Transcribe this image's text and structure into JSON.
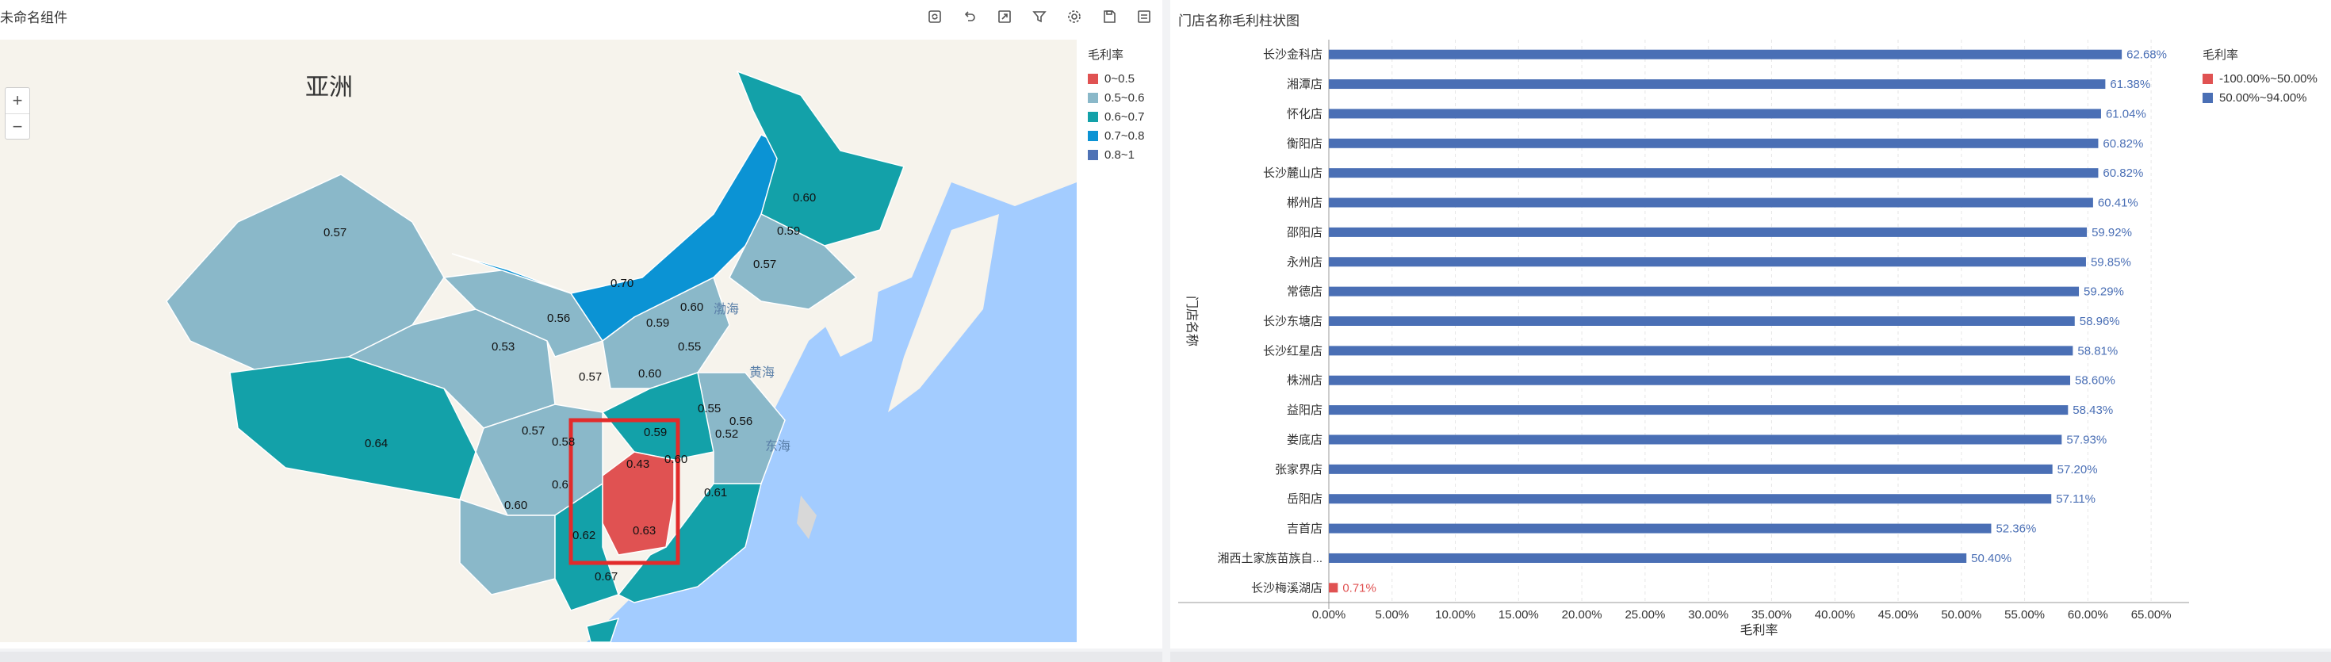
{
  "left": {
    "title": "未命名组件",
    "toolbar": [
      {
        "name": "refresh-icon"
      },
      {
        "name": "undo-icon"
      },
      {
        "name": "export-icon"
      },
      {
        "name": "filter-icon"
      },
      {
        "name": "settings-icon"
      },
      {
        "name": "save-icon"
      },
      {
        "name": "fullscreen-icon"
      }
    ],
    "zoom_in": "+",
    "zoom_out": "−",
    "map_labels": {
      "asia": "亚洲",
      "bohai": "渤海",
      "yellow_sea": "黄海",
      "east_sea": "东海"
    },
    "legend": {
      "title": "毛利率",
      "items": [
        {
          "label": "0~0.5",
          "color": "#e05252"
        },
        {
          "label": "0.5~0.6",
          "color": "#8ab8c9"
        },
        {
          "label": "0.6~0.7",
          "color": "#13a1a9"
        },
        {
          "label": "0.7~0.8",
          "color": "#0b93d4"
        },
        {
          "label": "0.8~1",
          "color": "#4f72b5"
        }
      ]
    },
    "province_values": [
      "0.57",
      "0.64",
      "0.53",
      "0.56",
      "0.70",
      "0.60",
      "0.59",
      "0.57",
      "0.59",
      "0.60",
      "0.55",
      "0.57",
      "0.60",
      "0.55",
      "0.56",
      "0.52",
      "0.57",
      "0.58",
      "0.43",
      "0.59",
      "0.60",
      "0.61",
      "0.6",
      "0.60",
      "0.62",
      "0.63",
      "0.67"
    ]
  },
  "right": {
    "title": "门店名称毛利柱状图",
    "legend": {
      "title": "毛利率",
      "items": [
        {
          "label": "-100.00%~50.00%",
          "color": "#e05252"
        },
        {
          "label": "50.00%~94.00%",
          "color": "#4a6fb5"
        }
      ]
    }
  },
  "chart_data": {
    "type": "bar",
    "orientation": "horizontal",
    "xlabel": "毛利率",
    "ylabel": "门店名称",
    "xlim": [
      0,
      0.68
    ],
    "x_ticks": [
      "0.00%",
      "5.00%",
      "10.00%",
      "15.00%",
      "20.00%",
      "25.00%",
      "30.00%",
      "35.00%",
      "40.00%",
      "45.00%",
      "50.00%",
      "55.00%",
      "60.00%",
      "65.00%"
    ],
    "categories": [
      "长沙金科店",
      "湘潭店",
      "怀化店",
      "衡阳店",
      "长沙麓山店",
      "郴州店",
      "邵阳店",
      "永州店",
      "常德店",
      "长沙东塘店",
      "长沙红星店",
      "株洲店",
      "益阳店",
      "娄底店",
      "张家界店",
      "岳阳店",
      "吉首店",
      "湘西土家族苗族自...",
      "长沙梅溪湖店"
    ],
    "values": [
      0.6268,
      0.6138,
      0.6104,
      0.6082,
      0.6082,
      0.6041,
      0.5992,
      0.5985,
      0.5929,
      0.5896,
      0.5881,
      0.586,
      0.5843,
      0.5793,
      0.572,
      0.5711,
      0.5236,
      0.504,
      0.0071
    ],
    "labels": [
      "62.68%",
      "61.38%",
      "61.04%",
      "60.82%",
      "60.82%",
      "60.41%",
      "59.92%",
      "59.85%",
      "59.29%",
      "58.96%",
      "58.81%",
      "58.60%",
      "58.43%",
      "57.93%",
      "57.20%",
      "57.11%",
      "52.36%",
      "50.40%",
      "0.71%"
    ],
    "grid": true,
    "legend_position": "top-right"
  }
}
